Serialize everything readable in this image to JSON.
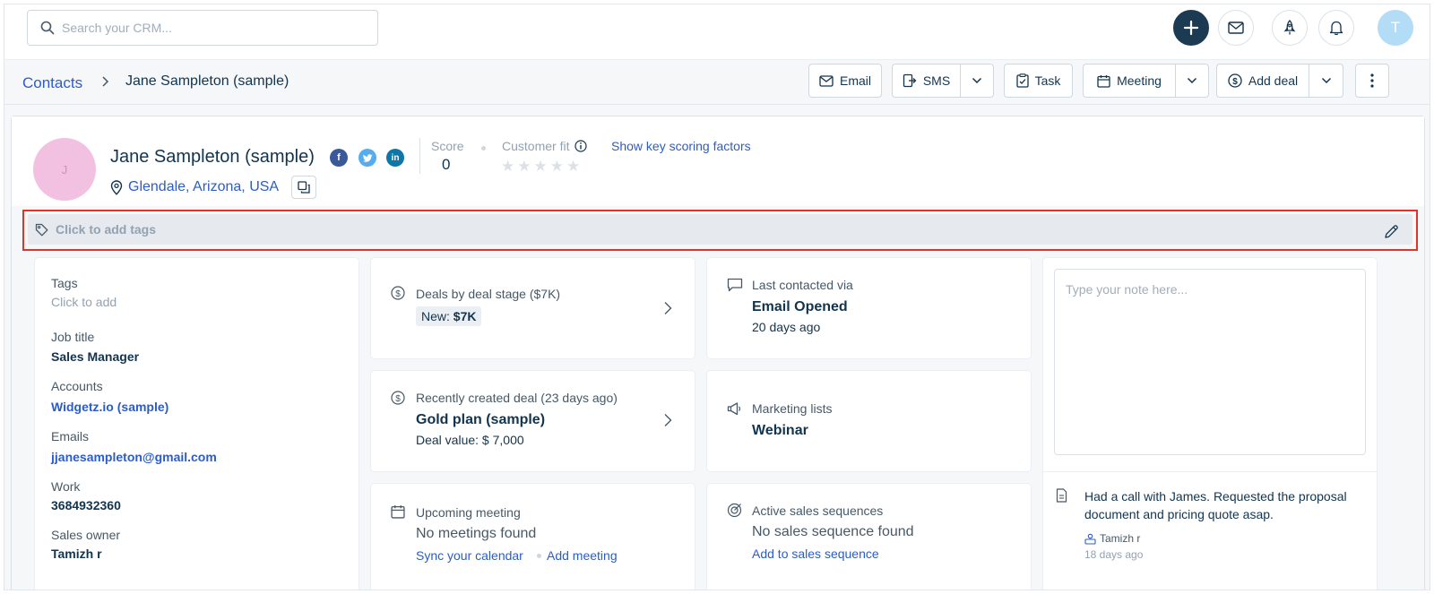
{
  "top": {
    "search_placeholder": "Search your CRM...",
    "avatar_initial": "T"
  },
  "breadcrumb": {
    "parent": "Contacts",
    "separator": "›",
    "current": "Jane Sampleton (sample)"
  },
  "actions": {
    "email": "Email",
    "sms": "SMS",
    "task": "Task",
    "meeting": "Meeting",
    "add_deal": "Add deal"
  },
  "contact": {
    "initial": "J",
    "name": "Jane Sampleton (sample)",
    "location": "Glendale, Arizona, USA",
    "score_label": "Score",
    "score_value": "0",
    "fit_label": "Customer fit",
    "fit_stars": 0,
    "show_scoring": "Show key scoring factors"
  },
  "tags_bar": {
    "placeholder": "Click to add tags"
  },
  "details": {
    "tags_label": "Tags",
    "tags_value": "Click to add",
    "job_label": "Job title",
    "job_value": "Sales Manager",
    "accounts_label": "Accounts",
    "accounts_value": "Widgetz.io (sample)",
    "emails_label": "Emails",
    "emails_value": "jjanesampleton@gmail.com",
    "work_label": "Work",
    "work_value": "3684932360",
    "owner_label": "Sales owner",
    "owner_value": "Tamizh r"
  },
  "widgets": {
    "deals_stage_label": "Deals by deal stage ($7K)",
    "deals_stage_prefix": "New:",
    "deals_stage_amount": "$7K",
    "recent_deal_label": "Recently created deal (23 days ago)",
    "recent_deal_name": "Gold plan (sample)",
    "recent_deal_value": "Deal value: $ 7,000",
    "meeting_label": "Upcoming meeting",
    "meeting_empty": "No meetings found",
    "meeting_sync": "Sync your calendar",
    "meeting_add": "Add meeting",
    "last_contact_label": "Last contacted via",
    "last_contact_value": "Email Opened",
    "last_contact_when": "20 days ago",
    "marketing_label": "Marketing lists",
    "marketing_value": "Webinar",
    "sequence_label": "Active sales sequences",
    "sequence_empty": "No sales sequence found",
    "sequence_add": "Add to sales sequence"
  },
  "notes": {
    "placeholder": "Type your note here...",
    "note_text_line1": "Had a call with James. Requested the proposal",
    "note_text_line2": "document and pricing quote asap.",
    "note_author": "Tamizh r",
    "note_time": "18 days ago"
  },
  "colors": {
    "link": "#2c5cc5",
    "primary_dark": "#1d3a53",
    "highlight_outline": "#e0342a"
  }
}
